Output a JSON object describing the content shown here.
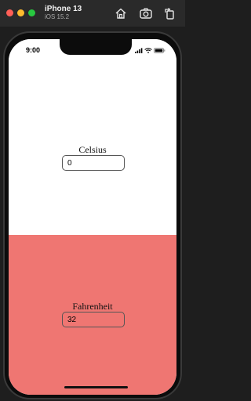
{
  "simulator": {
    "device_name": "iPhone 13",
    "os_version": "iOS 15.2",
    "icons": [
      "home-icon",
      "screenshot-camera-icon",
      "rotate-icon"
    ]
  },
  "status_bar": {
    "time": "9:00",
    "icons": [
      "cellular-icon",
      "wifi-icon",
      "battery-icon"
    ]
  },
  "celsius": {
    "label": "Celsius",
    "value": "0"
  },
  "fahrenheit": {
    "label": "Fahrenheit",
    "value": "32"
  },
  "colors": {
    "top_background": "#ffffff",
    "bottom_background": "#ef7672"
  }
}
